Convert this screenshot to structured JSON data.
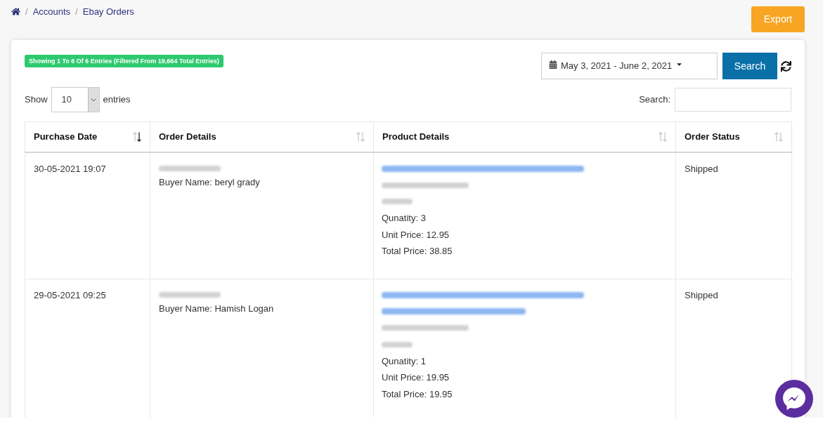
{
  "breadcrumb": [
    {
      "kind": "home"
    },
    {
      "kind": "link",
      "separator": "/",
      "label": "Accounts"
    },
    {
      "kind": "link",
      "separator": "/",
      "label": "Ebay Orders"
    }
  ],
  "export_button": {
    "label": "Export"
  },
  "summary_badge": "Showing 1 To 6 Of 6 Entries (Filtered From 19,664 Total Entries)",
  "date_range": {
    "value": "May 3, 2021 - June 2, 2021"
  },
  "search_button": {
    "label": "Search"
  },
  "length_menu": {
    "label_before": "Show",
    "value": "10",
    "label_after": "entries"
  },
  "search": {
    "label": "Search:"
  },
  "table": {
    "columns": [
      {
        "label": "Purchase Date",
        "sorted_descending": true
      },
      {
        "label": "Order Details",
        "sorted_descending": false
      },
      {
        "label": "Product Details",
        "sorted_descending": false
      },
      {
        "label": "Order Status",
        "sorted_descending": false
      }
    ],
    "rows": [
      {
        "purchase_date": "30-05-2021 19:07",
        "order_details": [
          {
            "kind": "redacted"
          },
          {
            "kind": "text",
            "text": "Buyer Name: beryl grady"
          }
        ],
        "product_details": [
          {
            "kind": "redacted-title"
          },
          {
            "kind": "redacted-item-id"
          },
          {
            "kind": "redacted-sku"
          },
          {
            "kind": "text",
            "text": "Qunatity: 3"
          },
          {
            "kind": "text",
            "text": "Unit Price: 12.95"
          },
          {
            "kind": "text",
            "text": "Total Price: 38.85"
          }
        ],
        "order_status": "Shipped"
      },
      {
        "purchase_date": "29-05-2021 09:25",
        "order_details": [
          {
            "kind": "redacted"
          },
          {
            "kind": "text",
            "text": "Buyer Name: Hamish Logan"
          }
        ],
        "product_details": [
          {
            "kind": "redacted-title"
          },
          {
            "kind": "redacted-title"
          },
          {
            "kind": "redacted-item-id"
          },
          {
            "kind": "redacted-sku"
          },
          {
            "kind": "text",
            "text": "Qunatity: 1"
          },
          {
            "kind": "text",
            "text": "Unit Price: 19.95"
          },
          {
            "kind": "text",
            "text": "Total Price: 19.95"
          }
        ],
        "order_status": "Shipped"
      }
    ]
  }
}
